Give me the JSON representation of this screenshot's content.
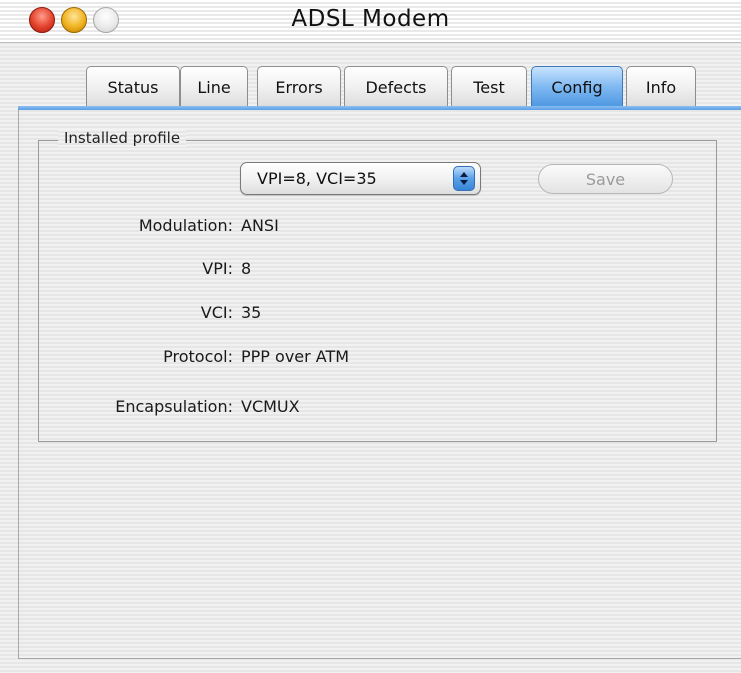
{
  "window": {
    "title": "ADSL Modem"
  },
  "tabs": [
    {
      "label": "Status",
      "active": false
    },
    {
      "label": "Line",
      "active": false
    },
    {
      "label": "Errors",
      "active": false
    },
    {
      "label": "Defects",
      "active": false
    },
    {
      "label": "Test",
      "active": false
    },
    {
      "label": "Config",
      "active": true
    },
    {
      "label": "Info",
      "active": false
    }
  ],
  "installed_profile": {
    "legend": "Installed profile",
    "profile_select": {
      "value": "VPI=8, VCI=35"
    },
    "save_label": "Save",
    "save_enabled": false,
    "fields": [
      {
        "label": "Modulation:",
        "value": "ANSI"
      },
      {
        "label": "VPI:",
        "value": "8"
      },
      {
        "label": "VCI:",
        "value": "35"
      },
      {
        "label": "Protocol:",
        "value": "PPP over ATM"
      },
      {
        "label": "Encapsulation:",
        "value": "VCMUX"
      }
    ]
  },
  "colors": {
    "active_tab": "#5ba0e8",
    "close_button": "#e3412b",
    "minimize_button": "#f0b21d",
    "zoom_button": "#d8d8d8",
    "disabled_text": "#9a9a9a"
  },
  "icons": [
    "close-button",
    "minimize-button",
    "zoom-button",
    "popup-up-down-arrows"
  ]
}
